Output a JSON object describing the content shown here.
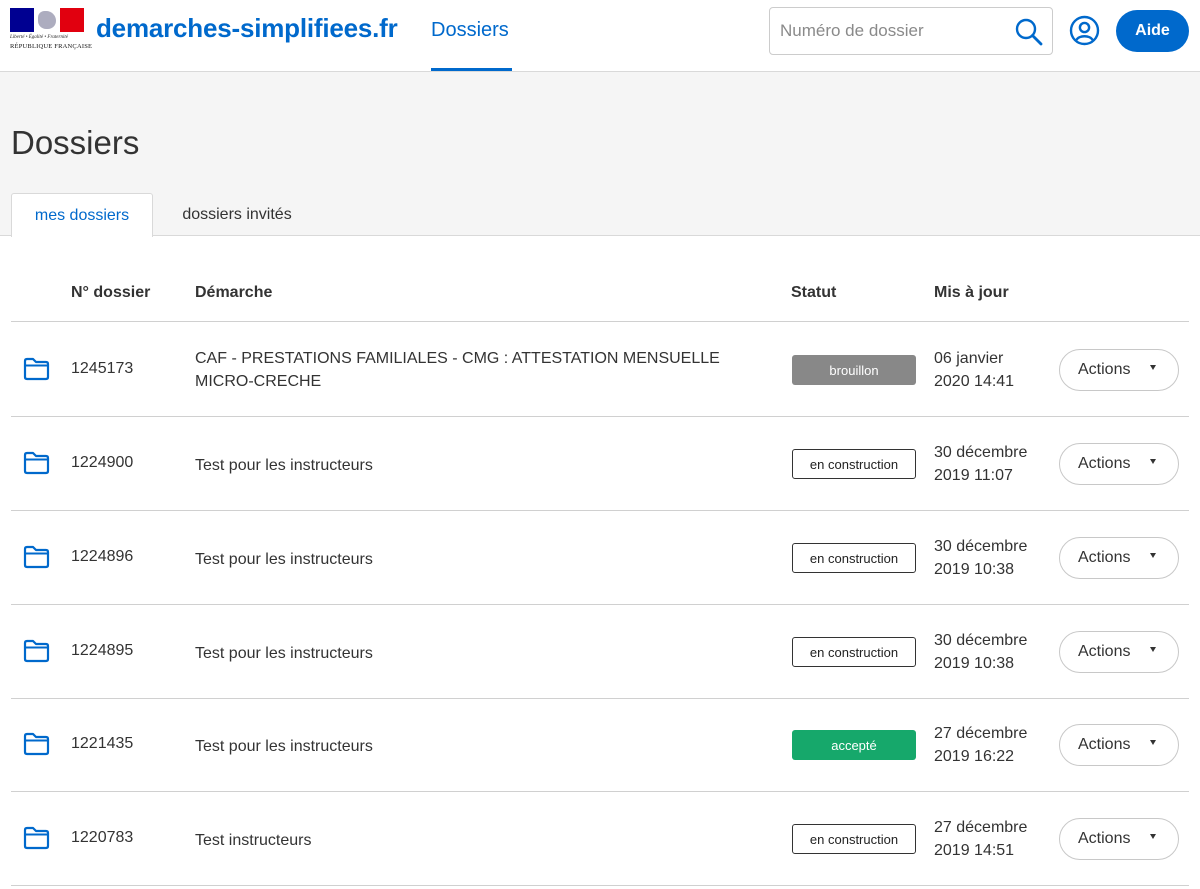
{
  "header": {
    "logo": {
      "motto": "Liberté • Égalité • Fraternité",
      "republic": "RÉPUBLIQUE FRANÇAISE",
      "flag_colors": [
        "#000091",
        "#ffffff",
        "#e1000f"
      ]
    },
    "brand": "demarches-simplifiees.fr",
    "nav_tab": "Dossiers",
    "search": {
      "placeholder": "Numéro de dossier",
      "value": "",
      "icon": "search-icon"
    },
    "user_icon": "user-circle-icon",
    "help_button": "Aide",
    "accent_color": "#0069cc"
  },
  "page": {
    "title": "Dossiers",
    "tabs": [
      {
        "label": "mes dossiers",
        "active": true
      },
      {
        "label": "dossiers invités",
        "active": false
      }
    ]
  },
  "table": {
    "columns": [
      "N° dossier",
      "Démarche",
      "Statut",
      "Mis à jour"
    ],
    "rows": [
      {
        "number": "1245173",
        "demarche": "CAF - PRESTATIONS FAMILIALES - CMG : ATTESTATION MENSUELLE MICRO-CRECHE",
        "status": "brouillon",
        "status_kind": "brouillon",
        "date_line1": "06 janvier",
        "date_line2": "2020 14:41",
        "actions": "Actions"
      },
      {
        "number": "1224900",
        "demarche": "Test pour les instructeurs",
        "status": "en construction",
        "status_kind": "construction",
        "date_line1": "30 décembre",
        "date_line2": "2019 11:07",
        "actions": "Actions"
      },
      {
        "number": "1224896",
        "demarche": "Test pour les instructeurs",
        "status": "en construction",
        "status_kind": "construction",
        "date_line1": "30 décembre",
        "date_line2": "2019 10:38",
        "actions": "Actions"
      },
      {
        "number": "1224895",
        "demarche": "Test pour les instructeurs",
        "status": "en construction",
        "status_kind": "construction",
        "date_line1": "30 décembre",
        "date_line2": "2019 10:38",
        "actions": "Actions"
      },
      {
        "number": "1221435",
        "demarche": "Test pour les instructeurs",
        "status": "accepté",
        "status_kind": "accepte",
        "date_line1": "27 décembre",
        "date_line2": "2019 16:22",
        "actions": "Actions"
      },
      {
        "number": "1220783",
        "demarche": "Test instructeurs",
        "status": "en construction",
        "status_kind": "construction",
        "date_line1": "27 décembre",
        "date_line2": "2019 14:51",
        "actions": "Actions"
      }
    ],
    "row_icon": "folder-icon",
    "status_colors": {
      "brouillon": "#888888",
      "construction": "#ffffff",
      "accepte": "#16a86b"
    }
  }
}
